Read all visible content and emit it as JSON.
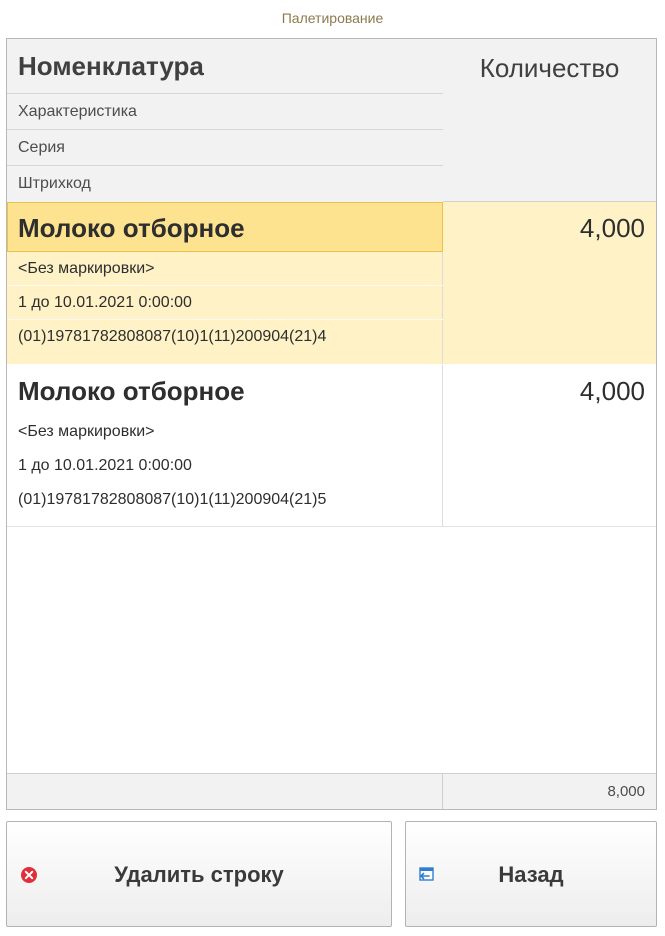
{
  "window": {
    "title": "Палетирование"
  },
  "table": {
    "columns": {
      "nomenclature": "Номенклатура",
      "characteristic": "Характеристика",
      "series": "Серия",
      "barcode": "Штрихкод",
      "quantity": "Количество"
    },
    "rows": [
      {
        "name": "Молоко отборное",
        "characteristic": "<Без маркировки>",
        "series": "1 до 10.01.2021 0:00:00",
        "barcode": "(01)19781782808087(10)1(11)200904(21)4",
        "quantity": "4,000",
        "selected": true
      },
      {
        "name": "Молоко отборное",
        "characteristic": "<Без маркировки>",
        "series": "1 до 10.01.2021 0:00:00",
        "barcode": "(01)19781782808087(10)1(11)200904(21)5",
        "quantity": "4,000",
        "selected": false
      }
    ],
    "total_quantity": "8,000"
  },
  "buttons": {
    "delete": {
      "label": "Удалить строку",
      "icon": "delete-circle-icon"
    },
    "back": {
      "label": "Назад",
      "icon": "back-window-icon"
    }
  },
  "colors": {
    "selected_row": "#fef2c6",
    "selected_cell": "#fde38f",
    "header_bg": "#f2f2f2",
    "title_text": "#8c7a4e",
    "delete_icon": "#e02f3a",
    "back_icon": "#2f7fd1"
  }
}
